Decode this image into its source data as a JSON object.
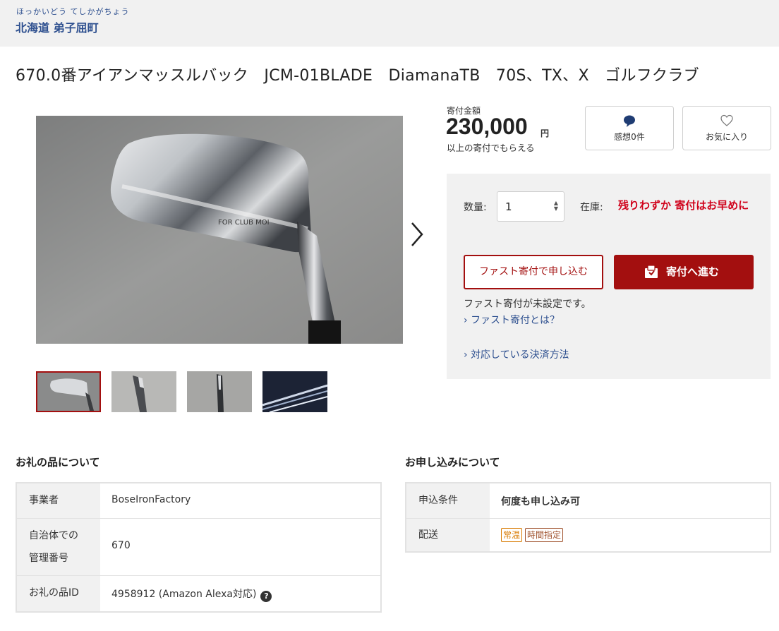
{
  "header": {
    "municipality_kana": "ほっかいどう てしかがちょう",
    "municipality_name": "北海道 弟子屈町"
  },
  "product": {
    "title": "670.0番アイアンマッスルバック　JCM-01BLADE　DiamanaTB　70S、TX、X　ゴルフクラブ",
    "image_engraving": "FOR CLUB MOI",
    "thumbnail_count": 4
  },
  "donation": {
    "amount_label": "寄付金額",
    "amount": "230,000",
    "unit": "円",
    "note": "以上の寄付でもらえる"
  },
  "actions": {
    "thanks_label": "感想0件",
    "favorite_label": "お気に入り"
  },
  "panel": {
    "quantity_label": "数量:",
    "quantity_value": "1",
    "stock_label": "在庫:",
    "stock_value": "残りわずか 寄付はお早めに",
    "fast_button": "ファスト寄付で申し込む",
    "donate_button": "寄付へ進む",
    "fast_note": "ファスト寄付が未設定です。",
    "fast_link": "ファスト寄付とは？",
    "payment_link": "対応している決済方法"
  },
  "gift_section": {
    "title": "お礼の品について",
    "rows": [
      {
        "label": "事業者",
        "value": "BoseIronFactory"
      },
      {
        "label": "自治体での\n管理番号",
        "value": "670"
      },
      {
        "label": "お礼の品ID",
        "value": "4958912 (Amazon Alexa対応)"
      }
    ]
  },
  "apply_section": {
    "title": "お申し込みについて",
    "rows": [
      {
        "label": "申込条件",
        "value": "何度も申し込み可"
      },
      {
        "label": "配送",
        "tags": [
          "常温",
          "時間指定"
        ]
      }
    ]
  },
  "colors": {
    "brand_red": "#a30f0f",
    "stock_red": "#d0021b",
    "link_blue": "#2d4f8f",
    "panel_bg": "#f1f1f1"
  }
}
